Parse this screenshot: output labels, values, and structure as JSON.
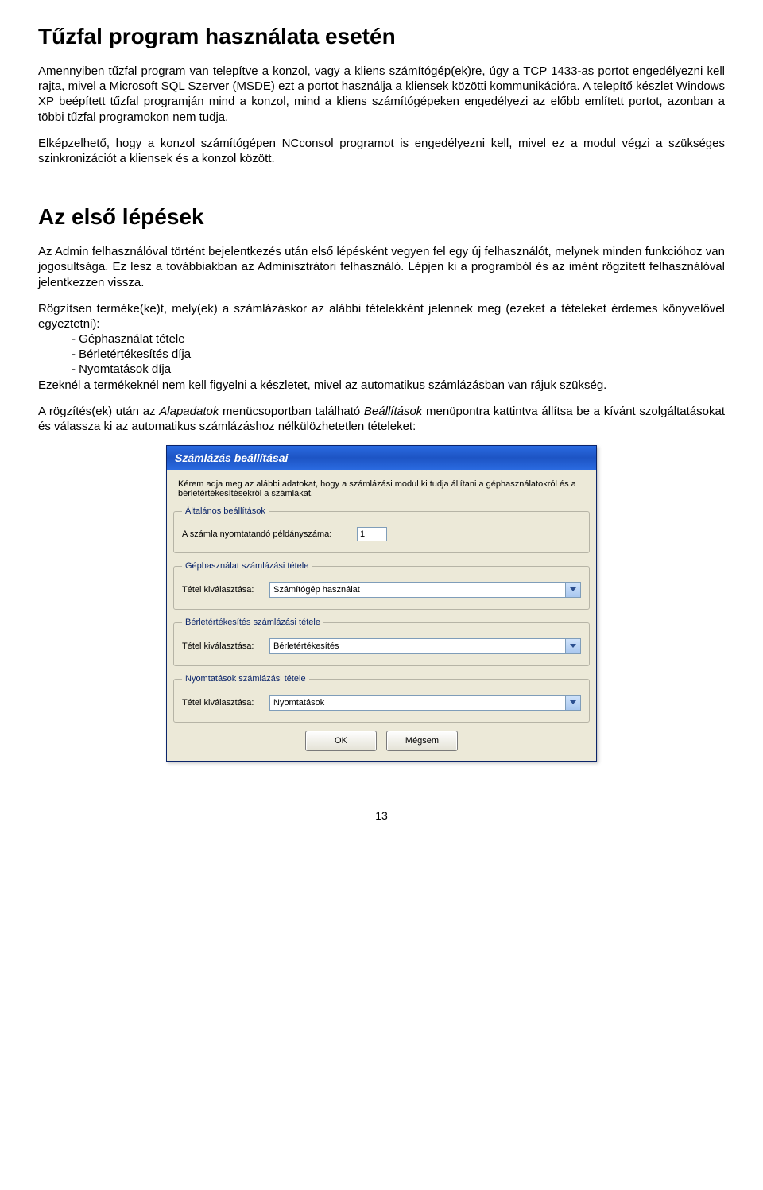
{
  "section1": {
    "heading": "Tűzfal program használata esetén",
    "p1": "Amennyiben tűzfal program van telepítve a konzol, vagy a kliens számítógép(ek)re, úgy a TCP 1433-as portot engedélyezni kell rajta, mivel a Microsoft SQL Szerver (MSDE) ezt a portot használja a kliensek közötti kommunikációra. A telepítő készlet Windows XP beépített tűzfal programján mind a konzol, mind a kliens számítógépeken engedélyezi az előbb említett portot, azonban a többi tűzfal programokon nem tudja.",
    "p2": "Elképzelhető, hogy a konzol számítógépen NCconsol programot is engedélyezni kell, mivel ez a modul végzi a szükséges szinkronizációt a kliensek és a konzol között."
  },
  "section2": {
    "heading": "Az első lépések",
    "p1": "Az Admin felhasználóval történt bejelentkezés után első lépésként vegyen fel egy új felhasználót, melynek minden funkcióhoz van jogosultsága. Ez lesz a továbbiakban az Adminisztrátori felhasználó. Lépjen ki a programból és az imént rögzített felhasználóval jelentkezzen vissza.",
    "p2": "Rögzítsen terméke(ke)t, mely(ek) a számlázáskor az alábbi tételekként jelennek meg (ezeket a tételeket érdemes könyvelővel egyeztetni):",
    "list": [
      "Géphasználat tétele",
      "Bérletértékesítés díja",
      "Nyomtatások díja"
    ],
    "p3": "Ezeknél a termékeknél nem kell figyelni a készletet, mivel az automatikus számlázásban van rájuk szükség.",
    "p4a": "A rögzítés(ek) után az ",
    "p4b": "Alapadatok",
    "p4c": " menücsoportban található ",
    "p4d": "Beállítások",
    "p4e": " menüpontra kattintva állítsa be a kívánt szolgáltatásokat és válassza ki az automatikus számlázáshoz nélkülözhetetlen tételeket:"
  },
  "dialog": {
    "title": "Számlázás beállításai",
    "intro": "Kérem adja meg az alábbi adatokat, hogy a számlázási modul ki tudja állítani a géphasználatokról és a bérletértékesítésekről a számlákat.",
    "group_general": "Általános beállítások",
    "label_copies": "A számla nyomtatandó példányszáma:",
    "value_copies": "1",
    "group_machine": "Géphasználat számlázási tétele",
    "label_select": "Tétel kiválasztása:",
    "select_machine": "Számítógép használat",
    "group_pass": "Bérletértékesítés számlázási tétele",
    "select_pass": "Bérletértékesítés",
    "group_print": "Nyomtatások számlázási tétele",
    "select_print": "Nyomtatások",
    "ok": "OK",
    "cancel": "Mégsem"
  },
  "pagenum": "13"
}
